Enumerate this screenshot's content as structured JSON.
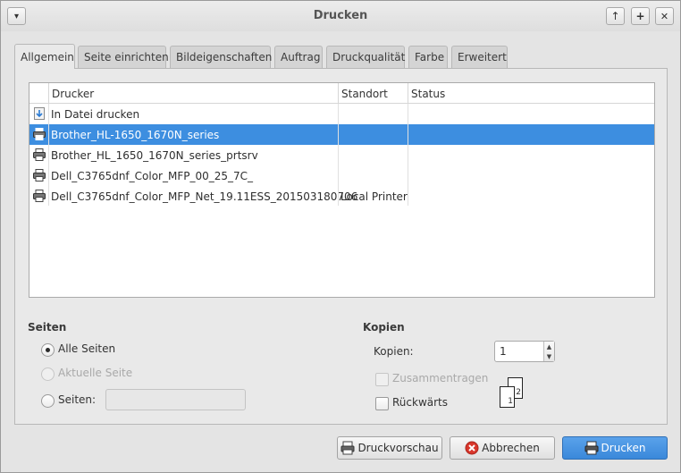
{
  "window": {
    "title": "Drucken",
    "menu_glyph": "▾",
    "btn_up": "↑",
    "btn_max": "+",
    "btn_close": "✕"
  },
  "tabs": [
    "Allgemein",
    "Seite einrichten",
    "Bildeigenschaften",
    "Auftrag",
    "Druckqualität",
    "Farbe",
    "Erweitert"
  ],
  "printer_list": {
    "columns": [
      "Drucker",
      "Standort",
      "Status"
    ],
    "rows": [
      {
        "name": "In Datei drucken",
        "location": "",
        "status": "",
        "icon": "file-download-icon"
      },
      {
        "name": "Brother_HL-1650_1670N_series",
        "location": "",
        "status": "",
        "icon": "printer-icon",
        "selected": true
      },
      {
        "name": "Brother_HL_1650_1670N_series_prtsrv",
        "location": "",
        "status": "",
        "icon": "printer-icon"
      },
      {
        "name": "Dell_C3765dnf_Color_MFP_00_25_7C_",
        "location": "",
        "status": "",
        "icon": "printer-icon"
      },
      {
        "name": "Dell_C3765dnf_Color_MFP_Net_19.11ESS_201503180706",
        "location": "Local Printer",
        "status": "",
        "icon": "printer-icon"
      }
    ]
  },
  "pages": {
    "title": "Seiten",
    "all_label": "Alle Seiten",
    "current_label": "Aktuelle Seite",
    "range_label": "Seiten:",
    "range_value": "",
    "selected": "all"
  },
  "copies": {
    "title": "Kopien",
    "count_label": "Kopien:",
    "count_value": "1",
    "collate_label": "Zusammentragen",
    "reverse_label": "Rückwärts",
    "collate_icon_front": "1",
    "collate_icon_back": "2"
  },
  "buttons": {
    "preview": "Druckvorschau",
    "cancel": "Abbrechen",
    "print": "Drucken"
  },
  "colors": {
    "selection": "#3d8ee0",
    "cancel_icon": "#d8362b"
  }
}
